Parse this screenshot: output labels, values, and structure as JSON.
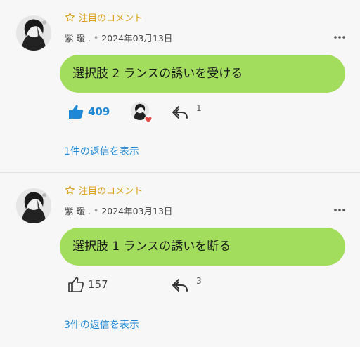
{
  "comments": [
    {
      "featured_label": "注目のコメント",
      "username": "紫 瑷 .",
      "separator": "•",
      "date": "2024年03月13日",
      "text": "選択肢 2 ランスの誘いを受ける",
      "likes": "409",
      "liked": true,
      "author_liked": true,
      "replies_count": "1",
      "replies_link": "1件の返信を表示"
    },
    {
      "featured_label": "注目のコメント",
      "username": "紫 瑷 .",
      "separator": "•",
      "date": "2024年03月13日",
      "text": "選択肢 1 ランスの誘いを断る",
      "likes": "157",
      "liked": false,
      "author_liked": false,
      "replies_count": "3",
      "replies_link": "3件の返信を表示"
    }
  ],
  "colors": {
    "bubble": "#a2dd5e",
    "accent_blue": "#1e88d6",
    "featured_gold": "#d9a21a",
    "heart_red": "#e84a4a",
    "background": "#f7f7f7"
  },
  "icons": [
    "star-outline-icon",
    "more-dots-icon",
    "thumbs-up-icon",
    "reply-arrow-icon",
    "heart-icon"
  ]
}
